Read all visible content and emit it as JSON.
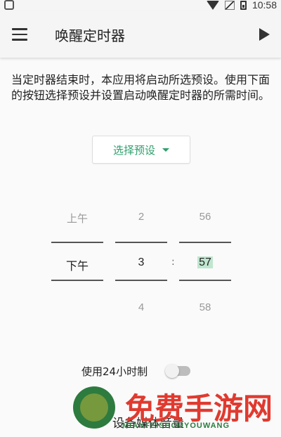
{
  "status_bar": {
    "time": "10:58"
  },
  "app_bar": {
    "title": "唤醒定时器"
  },
  "description": "当定时器结束时，本应用将启动所选预设。使用下面的按钮选择预设并设置启动唤醒定时器的所需时间。",
  "preset_button": {
    "label": "选择预设"
  },
  "picker": {
    "ampm": {
      "prev": "上午",
      "selected": "下午"
    },
    "hour": {
      "prev": "2",
      "selected": "3",
      "next": "4"
    },
    "separator": ":",
    "minute": {
      "prev": "56",
      "selected": "57",
      "next": "58"
    }
  },
  "toggle_24h": {
    "label": "使用24小时制",
    "on": false
  },
  "media_volume": {
    "label": "设备媒体音量"
  },
  "watermark": {
    "text": "免费手游网",
    "subtext": "MIANFEISHOUYOUWANG"
  }
}
